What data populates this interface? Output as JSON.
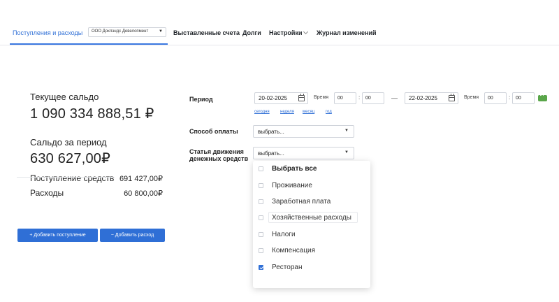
{
  "nav": {
    "tabs": [
      {
        "label": "Поступления и расходы",
        "active": true
      },
      {
        "label": "Выставленные счета"
      },
      {
        "label": "Долги"
      },
      {
        "label": "Настройки"
      },
      {
        "label": "Журнал изменений"
      }
    ],
    "company": "ООО Доклэндс Девелопмент"
  },
  "summary": {
    "current_balance_label": "Текущее сальдо",
    "current_balance_value": "1 090 334 888,51 ₽",
    "period_balance_label": "Сальдо за период",
    "period_balance_value": "630 627,00₽",
    "income_label": "Поступление средств",
    "income_value": "691 427,00₽",
    "expense_label": "Расходы",
    "expense_value": "60 800,00₽"
  },
  "actions": {
    "add_income": "+ Добавить поступление",
    "add_expense": "− Добавить расход"
  },
  "filters": {
    "period_label": "Период",
    "date_from": "20-02-2025",
    "date_to": "22-02-2025",
    "time_label": "Время",
    "time_from_h": "00",
    "time_from_m": "00",
    "time_to_h": "00",
    "time_to_m": "00",
    "dash": "—",
    "colon": ":",
    "quick": [
      "сегодня",
      "неделя",
      "месяц",
      "год"
    ],
    "payment_label": "Способ оплаты",
    "payment_value": "выбрать...",
    "article_label_1": "Статья движения",
    "article_label_2": "денежных средств",
    "article_value": "выбрать..."
  },
  "dropdown": {
    "select_all": "Выбрать все",
    "items": [
      {
        "label": "Проживание",
        "checked": false
      },
      {
        "label": "Заработная плата",
        "checked": false
      },
      {
        "label": "Хозяйственные расходы",
        "checked": false
      },
      {
        "label": "Налоги",
        "checked": false
      },
      {
        "label": "Компенсация",
        "checked": false
      },
      {
        "label": "Ресторан",
        "checked": true
      }
    ]
  },
  "colors": {
    "accent": "#2f6fd6",
    "apply": "#5aa64a"
  }
}
